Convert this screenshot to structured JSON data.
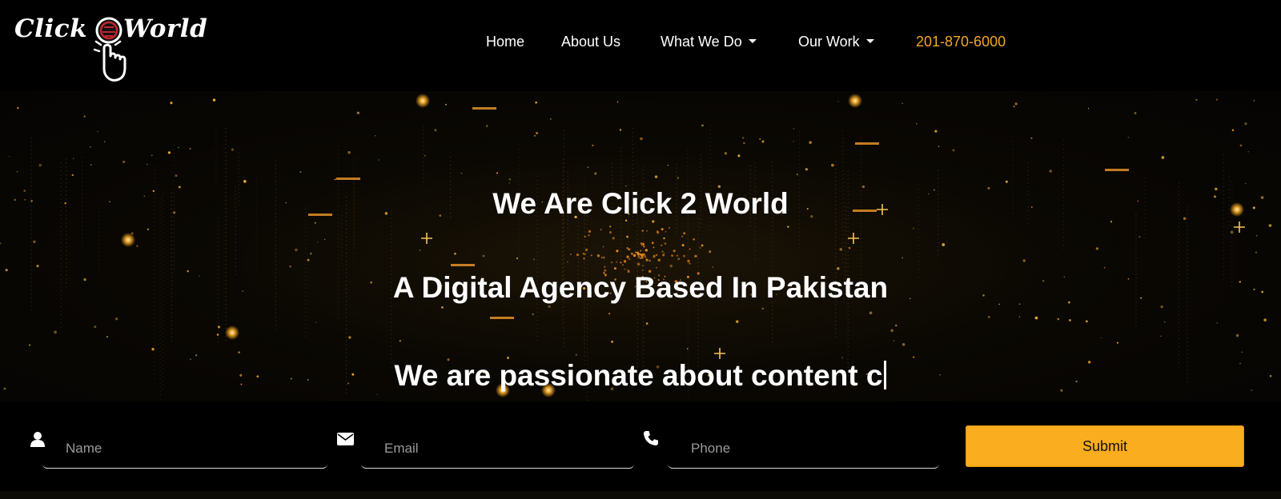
{
  "logo": {
    "word_left": "Click",
    "word_right": "World",
    "mark_icon": "hand-pointer-icon"
  },
  "nav": {
    "items": [
      {
        "label": "Home",
        "has_dropdown": false
      },
      {
        "label": "About Us",
        "has_dropdown": false
      },
      {
        "label": "What We Do",
        "has_dropdown": true
      },
      {
        "label": "Our Work",
        "has_dropdown": true
      }
    ],
    "phone": "201-870-6000",
    "phone_color": "#f5a623"
  },
  "hero": {
    "line1": "We Are Click 2 World",
    "line2": "A Digital Agency Based In Pakistan",
    "line3": "We are passionate about content c"
  },
  "form": {
    "name_placeholder": "Name",
    "email_placeholder": "Email",
    "phone_placeholder": "Phone",
    "name_icon": "user-icon",
    "email_icon": "envelope-icon",
    "phone_icon": "phone-icon",
    "submit_label": "Submit",
    "submit_color": "#f9ad1f"
  }
}
